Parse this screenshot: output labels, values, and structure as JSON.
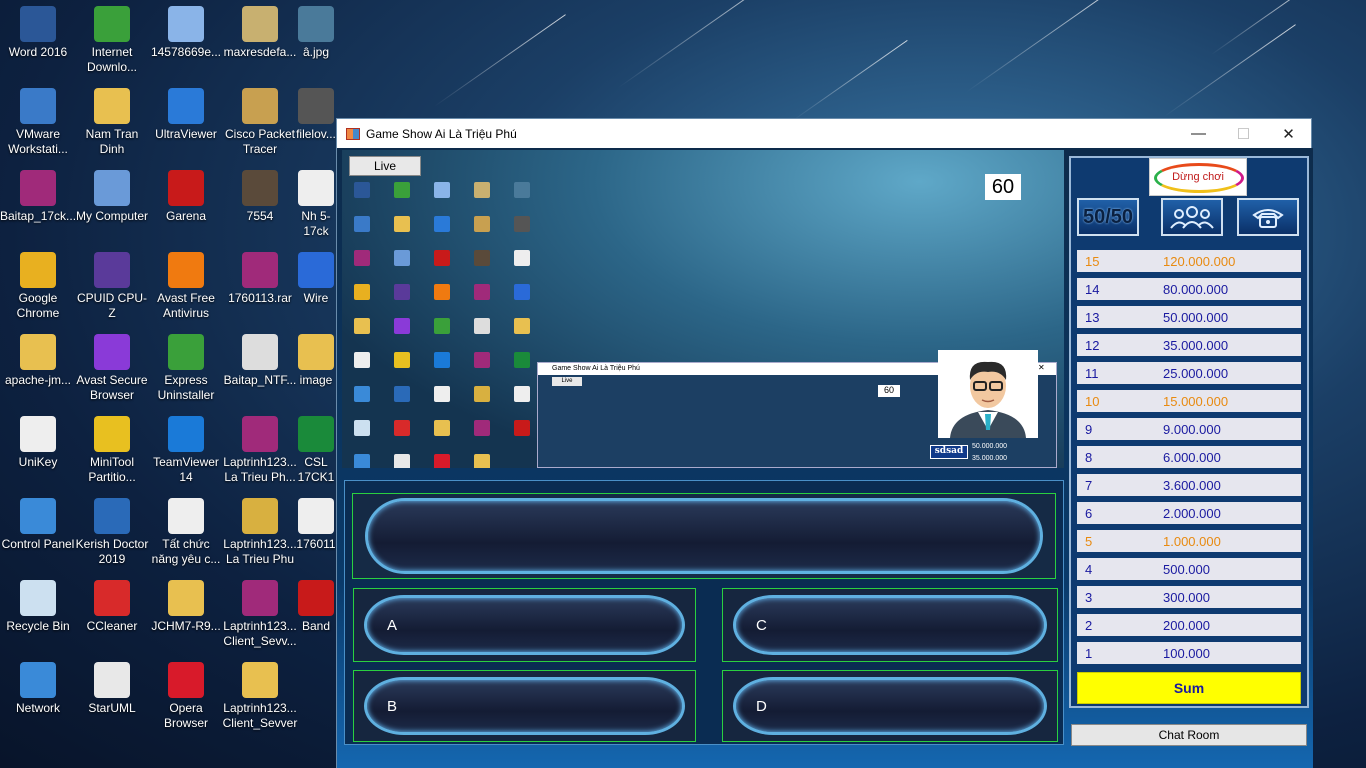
{
  "desktop": {
    "icons": [
      {
        "label": "Word 2016",
        "color": "#2b5797"
      },
      {
        "label": "Internet Downlo...",
        "color": "#3aa03a"
      },
      {
        "label": "14578669e...",
        "color": "#8ab4e8"
      },
      {
        "label": "maxresdefa...",
        "color": "#c8b070"
      },
      {
        "label": "â.jpg",
        "color": "#4a7a9a"
      },
      {
        "label": "VMware Workstati...",
        "color": "#3a7ac8"
      },
      {
        "label": "Nam Tran Dinh",
        "color": "#e8c050"
      },
      {
        "label": "UltraViewer",
        "color": "#2a7ad8"
      },
      {
        "label": "Cisco Packet Tracer",
        "color": "#c8a050"
      },
      {
        "label": "filelov...",
        "color": "#555555"
      },
      {
        "label": "Baitap_17ck...",
        "color": "#a02a7a"
      },
      {
        "label": "My Computer",
        "color": "#6a9ad8"
      },
      {
        "label": "Garena",
        "color": "#c81a1a"
      },
      {
        "label": "7554",
        "color": "#5a4a3a"
      },
      {
        "label": "Nh 5-17ck",
        "color": "#eeeeee"
      },
      {
        "label": "Google Chrome",
        "color": "#e8b020"
      },
      {
        "label": "CPUID CPU-Z",
        "color": "#5a3a9a"
      },
      {
        "label": "Avast Free Antivirus",
        "color": "#f07a10"
      },
      {
        "label": "1760113.rar",
        "color": "#a02a7a"
      },
      {
        "label": "Wire",
        "color": "#2a6ad8"
      },
      {
        "label": "apache-jm...",
        "color": "#e8c050"
      },
      {
        "label": "Avast Secure Browser",
        "color": "#8a3ad8"
      },
      {
        "label": "Express Uninstaller",
        "color": "#3aa03a"
      },
      {
        "label": "Baitap_NTF...",
        "color": "#dddddd"
      },
      {
        "label": "image",
        "color": "#e8c050"
      },
      {
        "label": "UniKey",
        "color": "#eeeeee"
      },
      {
        "label": "MiniTool Partitio...",
        "color": "#e8c020"
      },
      {
        "label": "TeamViewer 14",
        "color": "#1a7ad8"
      },
      {
        "label": "Laptrinh123... La Trieu Ph...",
        "color": "#a02a7a"
      },
      {
        "label": "CSL 17CK1",
        "color": "#1a8a3a"
      },
      {
        "label": "Control Panel",
        "color": "#3a8ad8"
      },
      {
        "label": "Kerish Doctor 2019",
        "color": "#2a6ab8"
      },
      {
        "label": "Tất chức năng yêu c...",
        "color": "#eeeeee"
      },
      {
        "label": "Laptrinh123... La Trieu Phu",
        "color": "#d8b040"
      },
      {
        "label": "176011",
        "color": "#eeeeee"
      },
      {
        "label": "Recycle Bin",
        "color": "#cce0f0"
      },
      {
        "label": "CCleaner",
        "color": "#d82a2a"
      },
      {
        "label": "JCHM7-R9...",
        "color": "#e8c050"
      },
      {
        "label": "Laptrinh123... Client_Sevv...",
        "color": "#a02a7a"
      },
      {
        "label": "Band",
        "color": "#c81a1a"
      },
      {
        "label": "Network",
        "color": "#3a8ad8"
      },
      {
        "label": "StarUML",
        "color": "#e8e8e8"
      },
      {
        "label": "Opera Browser",
        "color": "#d81a2a"
      },
      {
        "label": "Laptrinh123... Client_Sevver",
        "color": "#e8c050"
      }
    ]
  },
  "window": {
    "title": "Game Show Ai Là Triệu Phú",
    "minimize": "—",
    "maximize": "☐",
    "close": "✕"
  },
  "stream": {
    "live_label": "Live",
    "timer": "60",
    "nested_title": "Game Show Ai Là Triệu Phú",
    "nested_live": "Live",
    "nested_timer": "60",
    "nested_name": "sdsad",
    "nested_values": [
      "50.000.000",
      "35.000.000"
    ]
  },
  "question": {
    "text": "",
    "answers": {
      "a": "A",
      "b": "B",
      "c": "C",
      "d": "D"
    }
  },
  "panel": {
    "stop_label": "Dừng chơi",
    "lifelines": {
      "fifty": "50/50"
    },
    "ladder": [
      {
        "num": "15",
        "amount": "120.000.000",
        "milestone": true
      },
      {
        "num": "14",
        "amount": "80.000.000",
        "milestone": false
      },
      {
        "num": "13",
        "amount": "50.000.000",
        "milestone": false
      },
      {
        "num": "12",
        "amount": "35.000.000",
        "milestone": false
      },
      {
        "num": "11",
        "amount": "25.000.000",
        "milestone": false
      },
      {
        "num": "10",
        "amount": "15.000.000",
        "milestone": true
      },
      {
        "num": "9",
        "amount": "9.000.000",
        "milestone": false
      },
      {
        "num": "8",
        "amount": "6.000.000",
        "milestone": false
      },
      {
        "num": "7",
        "amount": "3.600.000",
        "milestone": false
      },
      {
        "num": "6",
        "amount": "2.000.000",
        "milestone": false
      },
      {
        "num": "5",
        "amount": "1.000.000",
        "milestone": true
      },
      {
        "num": "4",
        "amount": "500.000",
        "milestone": false
      },
      {
        "num": "3",
        "amount": "300.000",
        "milestone": false
      },
      {
        "num": "2",
        "amount": "200.000",
        "milestone": false
      },
      {
        "num": "1",
        "amount": "100.000",
        "milestone": false
      }
    ],
    "sum_label": "Sum",
    "chat_label": "Chat Room"
  },
  "colors": {
    "milestone": "#e88a10",
    "normal": "#1a1aa0",
    "sum_bg": "#ffff00",
    "answer_border": "#2ad040"
  }
}
